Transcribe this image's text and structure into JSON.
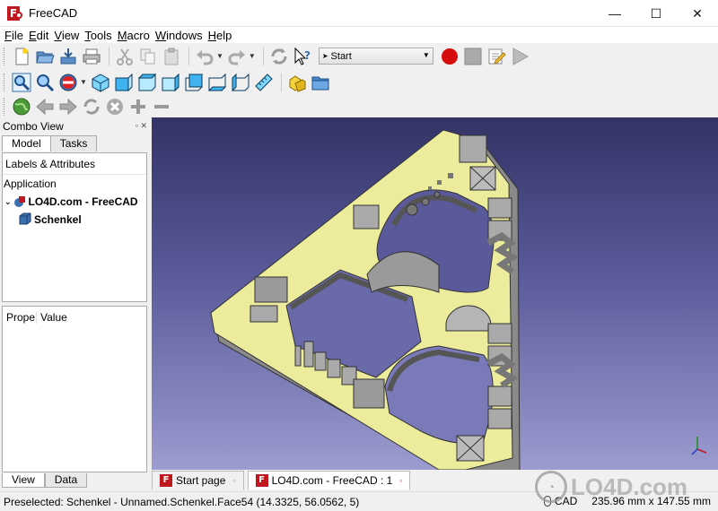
{
  "window": {
    "title": "FreeCAD"
  },
  "window_controls": {
    "minimize": "—",
    "maximize": "☐",
    "close": "✕"
  },
  "menu": [
    "File",
    "Edit",
    "View",
    "Tools",
    "Macro",
    "Windows",
    "Help"
  ],
  "workbench": {
    "selected": "Start"
  },
  "combo": {
    "title": "Combo View",
    "tabs": [
      "Model",
      "Tasks"
    ],
    "tree": {
      "header": "Labels & Attributes",
      "application": "Application",
      "document": "LO4D.com - FreeCAD",
      "object": "Schenkel"
    },
    "properties": {
      "col_property": "Prope",
      "col_value": "Value"
    },
    "bottom_tabs": [
      "View",
      "Data"
    ]
  },
  "doc_tabs": [
    {
      "label": "Start page",
      "active": false
    },
    {
      "label": "LO4D.com - FreeCAD : 1",
      "active": true
    }
  ],
  "status": {
    "preselected": "Preselected: Schenkel - Unnamed.Schenkel.Face54 (14.3325, 56.0562, 5)",
    "nav_style": "CAD",
    "dimensions": "235.96 mm x 147.55 mm"
  },
  "watermark": {
    "text": "LO4D.com"
  },
  "colors": {
    "model_face": "#ecec9c",
    "model_side": "#9a9a9a",
    "viewport_top": "#333366",
    "viewport_bottom": "#9c9cd0"
  }
}
